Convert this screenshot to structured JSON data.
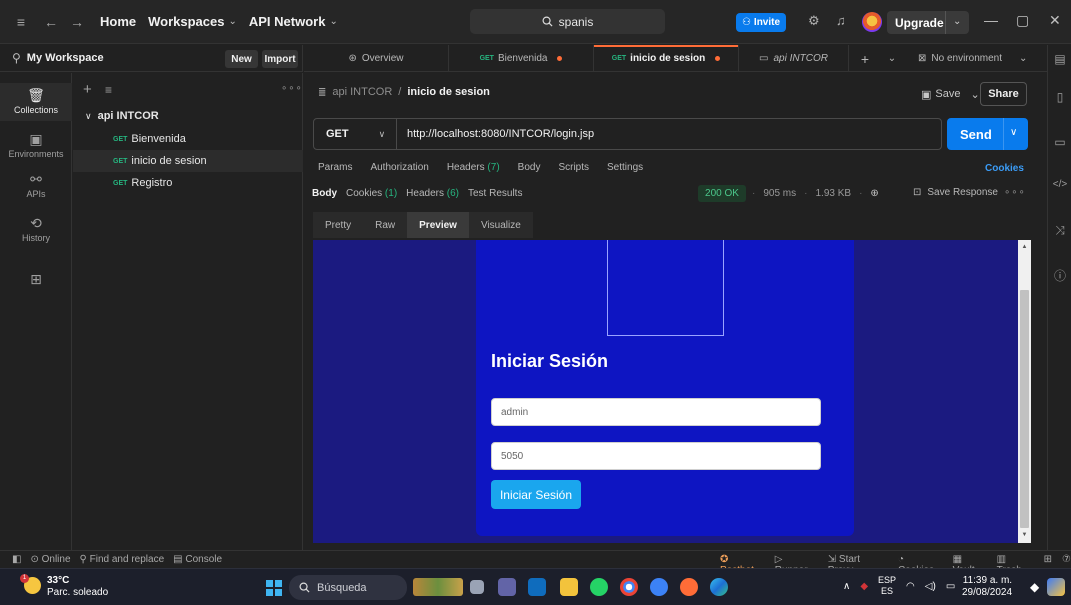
{
  "titlebar": {
    "home": "Home",
    "workspaces": "Workspaces",
    "api_network": "API Network",
    "search": "spanis",
    "invite": "Invite",
    "upgrade": "Upgrade"
  },
  "workspace": {
    "title": "My Workspace",
    "new_label": "New",
    "import_label": "Import"
  },
  "rail": [
    {
      "label": "Collections",
      "icon": "collections-icon"
    },
    {
      "label": "Environments",
      "icon": "environments-icon"
    },
    {
      "label": "APIs",
      "icon": "apis-icon"
    },
    {
      "label": "History",
      "icon": "history-icon"
    }
  ],
  "sidebar": {
    "folder": "api INTCOR",
    "requests": [
      {
        "method": "GET",
        "name": "Bienvenida"
      },
      {
        "method": "GET",
        "name": "inicio de sesion"
      },
      {
        "method": "GET",
        "name": "Registro"
      }
    ]
  },
  "tabs": [
    {
      "method": "",
      "label": "Overview"
    },
    {
      "method": "GET",
      "label": "Bienvenida"
    },
    {
      "method": "GET",
      "label": "inicio de sesion"
    },
    {
      "method": "",
      "label": "api INTCOR"
    }
  ],
  "environment": "No environment",
  "request": {
    "breadcrumb_parent": "api INTCOR",
    "breadcrumb_current": "inicio de sesion",
    "save_label": "Save",
    "share_label": "Share",
    "method": "GET",
    "url": "http://localhost:8080/INTCOR/login.jsp",
    "send_label": "Send",
    "tabs": {
      "params": "Params",
      "authorization": "Authorization",
      "headers": "Headers",
      "headers_count": "(7)",
      "body": "Body",
      "scripts": "Scripts",
      "settings": "Settings"
    },
    "cookies_link": "Cookies"
  },
  "response": {
    "tabs": {
      "body": "Body",
      "cookies": "Cookies",
      "cookies_count": "(1)",
      "headers": "Headers",
      "headers_count": "(6)",
      "test_results": "Test Results"
    },
    "status": "200 OK",
    "time": "905 ms",
    "size": "1.93 KB",
    "save_response": "Save Response",
    "view_tabs": [
      "Pretty",
      "Raw",
      "Preview",
      "Visualize"
    ]
  },
  "preview": {
    "title": "Iniciar Sesión",
    "username_value": "admin",
    "password_value": "5050",
    "button_label": "Iniciar Sesión"
  },
  "statusbar": {
    "online": "Online",
    "find_replace": "Find and replace",
    "console": "Console",
    "postbot": "Postbot",
    "runner": "Runner",
    "start_proxy": "Start Proxy",
    "cookies": "Cookies",
    "vault": "Vault",
    "trash": "Trash"
  },
  "taskbar": {
    "temp": "33°C",
    "weather": "Parc. soleado",
    "weather_badge": "1",
    "search": "Búsqueda",
    "lang_top": "ESP",
    "lang_bottom": "ES",
    "time": "11:39 a. m.",
    "date": "29/08/2024"
  },
  "colors": {
    "accent": "#ff6c37",
    "primary": "#097bed",
    "get_method": "#26b47f",
    "preview_bg": "#1b1a80",
    "card_bg": "#0e15c2"
  }
}
